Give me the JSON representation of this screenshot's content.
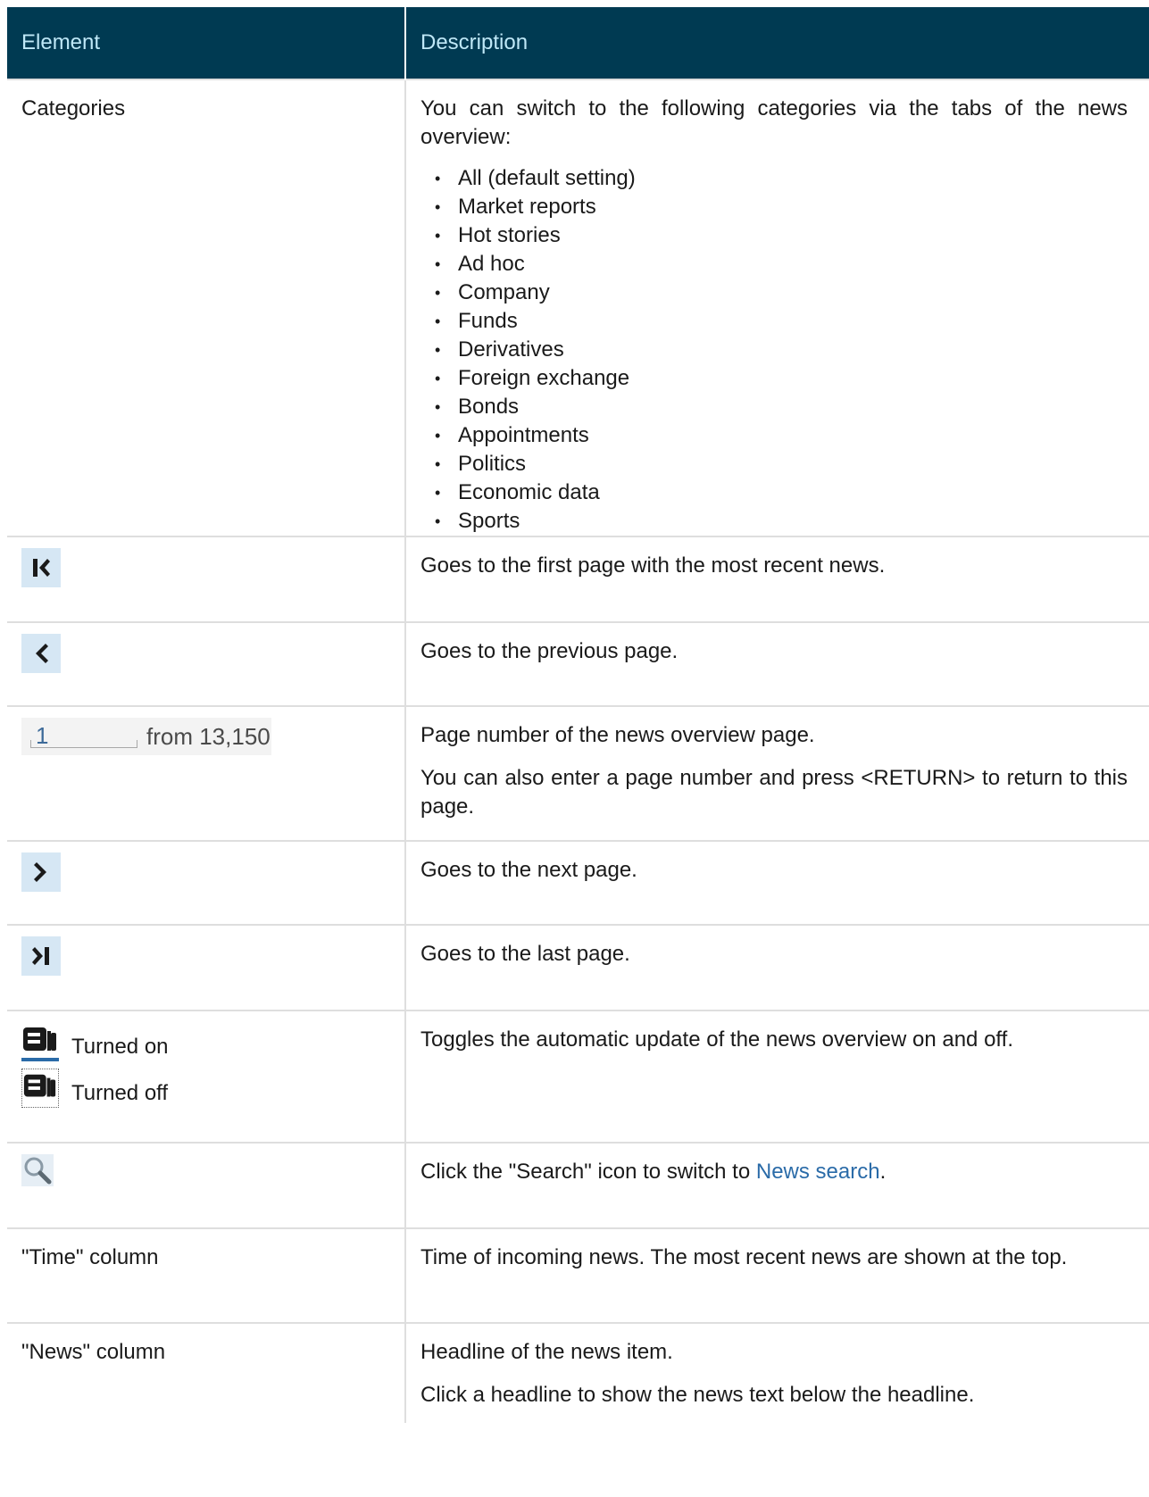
{
  "header": {
    "element": "Element",
    "description": "Description"
  },
  "categories": {
    "label": "Categories",
    "intro": "You can switch to the following categories via the tabs of the news overview:",
    "items": [
      "All (default setting)",
      "Market reports",
      "Hot stories",
      "Ad hoc",
      "Company",
      "Funds",
      "Derivatives",
      "Foreign exchange",
      "Bonds",
      "Appointments",
      "Politics",
      "Economic data",
      "Sports"
    ]
  },
  "first_page": {
    "icon": "first-page-icon",
    "description": "Goes to the first page with the most recent news."
  },
  "previous_page": {
    "icon": "previous-page-icon",
    "description": "Goes to the previous page."
  },
  "page_number": {
    "value": "1",
    "suffix": "from 13,150",
    "description": "Page number of the news overview page.",
    "description2": "You can also enter a page number and press <RETURN> to return to this page."
  },
  "next_page": {
    "icon": "next-page-icon",
    "description": "Goes to the next page."
  },
  "last_page": {
    "icon": "last-page-icon",
    "description": "Goes to the last page."
  },
  "auto_update": {
    "on_label": "Turned on",
    "off_label": "Turned off",
    "description": "Toggles the automatic update of the news overview on and off."
  },
  "search": {
    "icon": "search-icon",
    "description_prefix": "Click the \"Search\" icon to switch to ",
    "link": "News search",
    "description_suffix": "."
  },
  "time_column": {
    "label": "\"Time\" column",
    "description": "Time of incoming news. The most recent news are shown at the top."
  },
  "news_column": {
    "label": "\"News\" column",
    "description": "Headline of the news item.",
    "description2": "Click a headline to show the news text below the headline."
  },
  "colors": {
    "header_bg": "#003a52",
    "header_text": "#bfe8f7",
    "icon_bg": "#d6e7f4",
    "link": "#2a6ba8"
  }
}
